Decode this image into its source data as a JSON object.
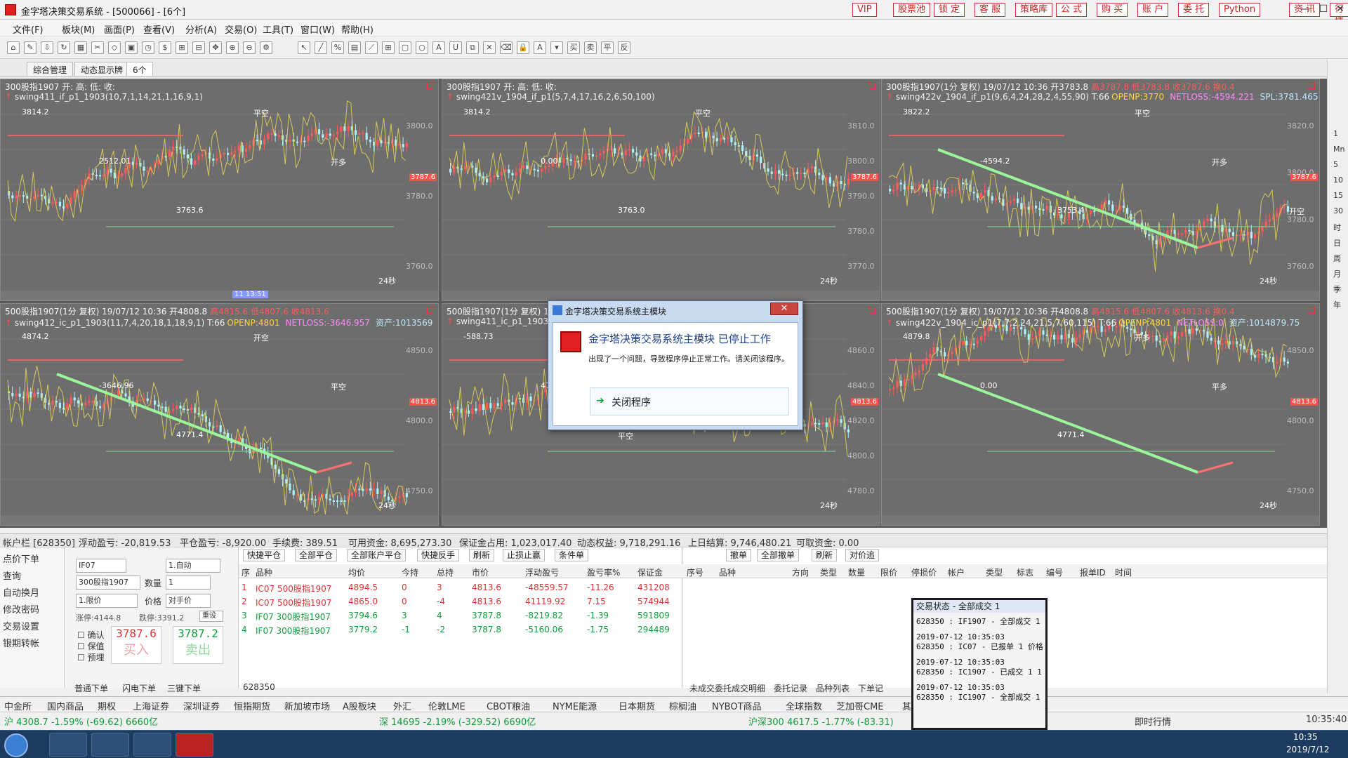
{
  "window": {
    "title": "金字塔决策交易系统 - [500066] - [6个]",
    "buttons": [
      "VIP",
      "股票池",
      "锁 定",
      "客 服",
      "策略库",
      "公 式",
      "购 买",
      "账 户",
      "委 托",
      "Python",
      "资 讯",
      "行 情"
    ]
  },
  "menu": [
    "文件(F)",
    "板块(M)",
    "画面(P)",
    "查看(V)",
    "分析(A)",
    "交易(O)",
    "工具(T)",
    "窗口(W)",
    "帮助(H)"
  ],
  "tabs": [
    "综合管理",
    "动态显示牌",
    "6个"
  ],
  "charts": [
    {
      "head": "300股指1907 开: 高: 低: 收:",
      "sub": "swing411_if_p1_1903(10,7,1,14,21,1,16,9,1)",
      "labels": [
        "3814.2",
        "2512.01",
        "3763.6",
        "平空",
        "开多"
      ],
      "price": "3787.6",
      "axis": [
        "3800.0",
        "3780.0",
        "3760.0"
      ],
      "count": "24秒",
      "time": "11 13:51"
    },
    {
      "head": "300股指1907 开: 高: 低: 收:",
      "sub": "swing421v_1904_if_p1(5,7,4,17,16,2,6,50,100)",
      "labels": [
        "3814.2",
        "0.00",
        "3763.0",
        "平空"
      ],
      "price": "3787.6",
      "axis": [
        "3810.0",
        "3800.0",
        "3790.0",
        "3780.0",
        "3770.0"
      ],
      "count": "24秒"
    },
    {
      "head": "300股指1907(1分 复权) 19/07/12 10:36 开3783.8",
      "headR": "高3787.8 低3783.8 收3787.6 换0.4",
      "sub": "swing422v_1904_if_p1(9,6,4,24,28,2,4,55,90) T:66",
      "subY": "OPENP:3770",
      "subM": "NETLOSS:-4594.221",
      "subG": "SPL:3781.465",
      "labels": [
        "3822.2",
        "-4594.2",
        "3753.4",
        "平空",
        "开多",
        "开空"
      ],
      "price": "3787.6",
      "axis": [
        "3820.0",
        "3800.0",
        "3780.0",
        "3760.0"
      ],
      "count": "24秒"
    },
    {
      "head": "500股指1907(1分 复权) 19/07/12 10:36 开4808.8",
      "headR": "高4815.6 低4807.6 收4813.6",
      "sub": "swing412_ic_p1_1903(11,7,4,20,18,1,18,9,1) T:66",
      "subY": "OPENP:4801",
      "subM": "NETLOSS:-3646.957",
      "subG": "资产:1013569",
      "labels": [
        "4874.2",
        "-3646.96",
        "4771.4",
        "开空",
        "平空"
      ],
      "price": "4813.6",
      "axis": [
        "4850.0",
        "4800.0",
        "4750.0"
      ],
      "count": "24秒"
    },
    {
      "head": "500股指1907(1分 复权) 19/07/12 10:36",
      "sub": "swing411_ic_p1_1903(",
      "labels": [
        "-588.73",
        "4771.4",
        "平空"
      ],
      "price": "4813.6",
      "axis": [
        "4860.0",
        "4840.0",
        "4820.0",
        "4800.0",
        "4780.0"
      ],
      "count": "24秒"
    },
    {
      "head": "500股指1907(1分 复权) 19/07/12 10:36 开4808.8",
      "headR": "高4815.6 低4807.6 收4813.6 换0.4",
      "sub": "swing422v_1904_ic_p1(7,7,2,24,21,5,7,60,115) T:66",
      "subY": "OPENP:4801",
      "subM": "NETLOSS:0",
      "subG": "资产:1014879.75",
      "labels": [
        "4879.8",
        "0.00",
        "4771.4",
        "开多",
        "平多"
      ],
      "price": "4813.6",
      "axis": [
        "4850.0",
        "4800.0",
        "4750.0"
      ],
      "count": "24秒"
    }
  ],
  "account": {
    "label": "帐户栏 [628350]",
    "float_pl": "浮动盈亏: -20,819.53",
    "close_pl": "平仓盈亏: -8,920.00",
    "fee": "手续费: 389.51",
    "avail": "可用资金: 8,695,273.30",
    "margin": "保证金占用: 1,023,017.40",
    "equity": "动态权益: 9,718,291.16",
    "prev": "上日结算: 9,746,480.21",
    "withdraw": "可取资金: 0.00"
  },
  "leftnav": [
    "点价下单",
    "查询",
    "自动换月",
    "修改密码",
    "交易设置",
    "银期转帐"
  ],
  "order": {
    "code": "IF07",
    "name": "300股指1907",
    "mode": "1.自动",
    "qty": "1",
    "type": "1.限价",
    "price": "对手价",
    "limit_up": "涨停:4144.8",
    "limit_down": "跌停:3391.2",
    "check": "重设",
    "confirm": "确认",
    "hedge": "保值",
    "preset": "预埋",
    "bid": "3787.6",
    "ask": "3787.2",
    "buy": "买入",
    "sell": "卖出",
    "tabs": [
      "普通下单",
      "闪电下单",
      "三键下单"
    ],
    "account_no": "628350"
  },
  "positions": {
    "buttons": [
      "快捷平仓",
      "全部平仓",
      "全部账户平仓",
      "快捷反手",
      "刷新",
      "止损止赢",
      "条件单"
    ],
    "headers": [
      "序",
      "品种",
      "均价",
      "今持",
      "总持",
      "市价",
      "浮动盈亏",
      "盈亏率%",
      "保证金"
    ],
    "rows": [
      [
        "1",
        "IC07 500股指1907",
        "4894.5",
        "0",
        "3",
        "4813.6",
        "-48559.57",
        "-11.26",
        "431208"
      ],
      [
        "2",
        "IC07 500股指1907",
        "4865.0",
        "0",
        "-4",
        "4813.6",
        "41119.92",
        "7.15",
        "574944"
      ],
      [
        "3",
        "IF07 300股指1907",
        "3794.6",
        "3",
        "4",
        "3787.8",
        "-8219.82",
        "-1.39",
        "591809"
      ],
      [
        "4",
        "IF07 300股指1907",
        "3779.2",
        "-1",
        "-2",
        "3787.8",
        "-5160.06",
        "-1.75",
        "294489"
      ]
    ]
  },
  "orders": {
    "buttons": [
      "撤单",
      "全部撤单",
      "刷新",
      "对价追"
    ],
    "headers": [
      "序号",
      "品种",
      "方向",
      "类型",
      "数量",
      "限价",
      "停损价",
      "帐户",
      "类型",
      "标志",
      "编号",
      "报单ID",
      "时间"
    ],
    "tabs": [
      "未成交委托",
      "成交明细",
      "委托记录",
      "品种列表",
      "下单记"
    ]
  },
  "markets": [
    "中金所",
    "国内商品",
    "期权",
    "上海证券",
    "深圳证券",
    "恒指期货",
    "新加坡市场",
    "A股板块",
    "外汇",
    "伦敦LME",
    "CBOT粮油",
    "NYME能源",
    "日本期货",
    "棕榈油",
    "NYBOT商品",
    "全球指数",
    "芝加哥CME",
    "其他金融期货"
  ],
  "ticker": {
    "sh": "沪 4308.7 -1.59% (-69.62) 6660亿",
    "sz": "深 14695 -2.19% (-329.52) 6690亿",
    "hs300": "沪深300 4617.5 -1.77% (-83.31)",
    "status": "即时行情",
    "time": "10:35:40"
  },
  "dialog": {
    "title": "金字塔决策交易系统主模块",
    "close": "✕",
    "heading": "金字塔决策交易系统主模块 已停止工作",
    "message": "出现了一个问题，导致程序停止正常工作。请关闭该程序。",
    "action": "关闭程序"
  },
  "popup": {
    "title": "交易状态 - 全部成交 1",
    "lines": [
      "628350 : IF1907 - 全部成交 1",
      "",
      "2019-07-12 10:35:03",
      "628350 : IC07 - 已报单 1 价格",
      "",
      "2019-07-12 10:35:03",
      "628350 : IC1907 - 已成交 1 1",
      "",
      "2019-07-12 10:35:03",
      "628350 : IC1907 - 全部成交 1"
    ]
  },
  "taskbar": {
    "time": "10:35",
    "date": "2019/7/12"
  },
  "sidebar": [
    "1",
    "Mn",
    "5",
    "10",
    "15",
    "30",
    "时",
    "日",
    "周",
    "月",
    "季",
    "年"
  ]
}
